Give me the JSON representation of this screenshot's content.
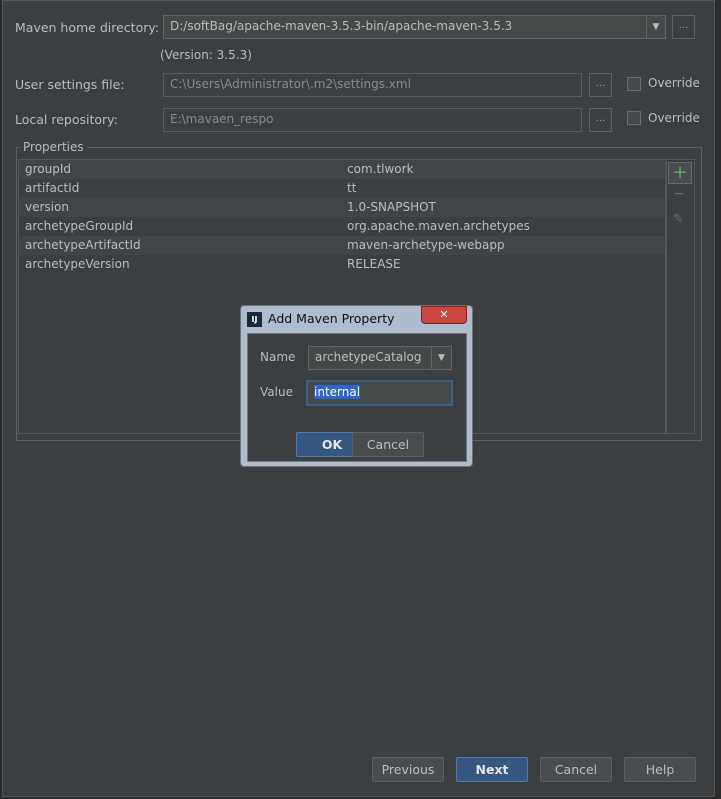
{
  "maven_home": {
    "label": "Maven home directory:",
    "value": "D:/softBag/apache-maven-3.5.3-bin/apache-maven-3.5.3",
    "version": "(Version: 3.5.3)"
  },
  "user_settings": {
    "label": "User settings file:",
    "value": "C:\\Users\\Administrator\\.m2\\settings.xml",
    "override": "Override",
    "checked": false
  },
  "local_repo": {
    "label": "Local repository:",
    "value": "E:\\mavaen_respo",
    "override": "Override",
    "checked": false
  },
  "browse_label": "...",
  "properties": {
    "title": "Properties",
    "rows": [
      {
        "name": "groupId",
        "value": "com.tlwork"
      },
      {
        "name": "artifactId",
        "value": "tt"
      },
      {
        "name": "version",
        "value": "1.0-SNAPSHOT"
      },
      {
        "name": "archetypeGroupId",
        "value": "org.apache.maven.archetypes"
      },
      {
        "name": "archetypeArtifactId",
        "value": "maven-archetype-webapp"
      },
      {
        "name": "archetypeVersion",
        "value": "RELEASE"
      }
    ],
    "add": "+",
    "remove": "−",
    "edit": "✎"
  },
  "dialog": {
    "title": "Add Maven Property",
    "logo": "IJ",
    "close": "✕",
    "name_label": "Name",
    "name_value": "archetypeCatalog",
    "value_label": "Value",
    "value_value": "internal",
    "ok": "OK",
    "cancel": "Cancel"
  },
  "footer": {
    "previous": "Previous",
    "next": "Next",
    "cancel": "Cancel",
    "help": "Help"
  }
}
